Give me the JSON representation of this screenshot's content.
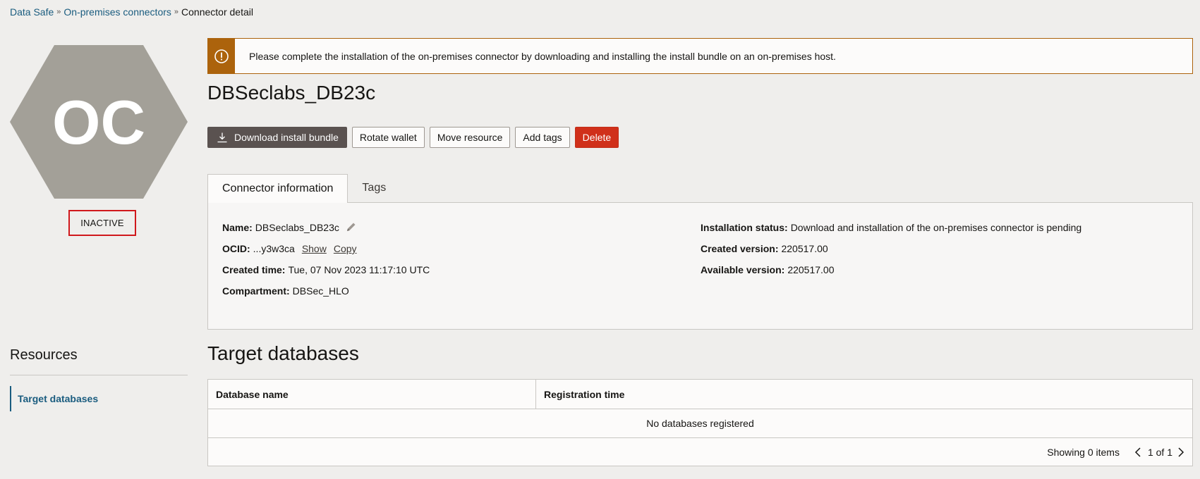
{
  "breadcrumb": {
    "items": [
      "Data Safe",
      "On-premises connectors"
    ],
    "current": "Connector detail"
  },
  "avatar": {
    "initials": "OC",
    "color": "#a3a098"
  },
  "status": {
    "label": "INACTIVE"
  },
  "resources": {
    "title": "Resources",
    "items": [
      "Target databases"
    ]
  },
  "alert": {
    "message": "Please complete the installation of the on-premises connector by downloading and installing the install bundle on an on-premises host.",
    "icon": "warning-circle-icon",
    "color": "#ac630c"
  },
  "page": {
    "title": "DBSeclabs_DB23c"
  },
  "actions": {
    "download": "Download install bundle",
    "rotate": "Rotate wallet",
    "move": "Move resource",
    "tags": "Add tags",
    "delete": "Delete"
  },
  "tabs": [
    "Connector information",
    "Tags"
  ],
  "info": {
    "name_label": "Name:",
    "name_value": "DBSeclabs_DB23c",
    "ocid_label": "OCID:",
    "ocid_value": "...y3w3ca",
    "ocid_show": "Show",
    "ocid_copy": "Copy",
    "created_time_label": "Created time:",
    "created_time_value": "Tue, 07 Nov 2023 11:17:10 UTC",
    "compartment_label": "Compartment:",
    "compartment_value": "DBSec_HLO",
    "install_status_label": "Installation status:",
    "install_status_value": "Download and installation of the on-premises connector is pending",
    "created_version_label": "Created version:",
    "created_version_value": "220517.00",
    "available_version_label": "Available version:",
    "available_version_value": "220517.00"
  },
  "target_databases": {
    "title": "Target databases",
    "columns": [
      "Database name",
      "Registration time"
    ],
    "empty_message": "No databases registered",
    "showing": "Showing 0 items",
    "pagination": "1 of 1"
  },
  "colors": {
    "link": "#1a5c7f",
    "primary_button": "#5a5250",
    "danger_button": "#d0301a",
    "status_highlight": "#d0181c"
  }
}
